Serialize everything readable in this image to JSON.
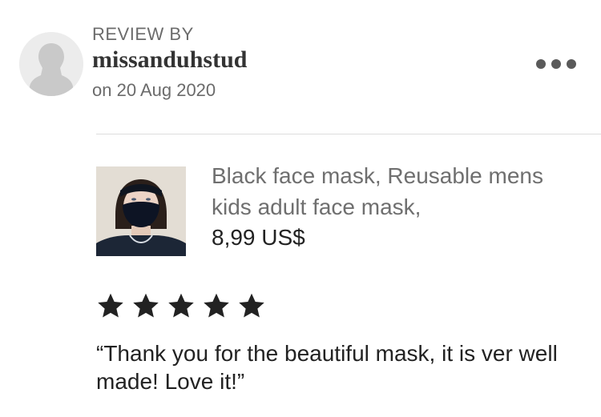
{
  "review": {
    "header_label": "REVIEW BY",
    "username": "missanduhstud",
    "date": "on 20 Aug 2020",
    "rating": 5,
    "rating_max": 5,
    "text": "“Thank you for the beautiful mask, it is ver well made! Love it!”"
  },
  "product": {
    "title": "Black face mask, Reusable mens kids adult face mask,",
    "price": "8,99 US$"
  },
  "icons": {
    "avatar": "default-user-avatar-icon",
    "more": "more-options-icon",
    "star": "star-icon"
  },
  "colors": {
    "star": "#222222",
    "muted_text": "#6b6b6b",
    "divider": "#dddddd"
  }
}
